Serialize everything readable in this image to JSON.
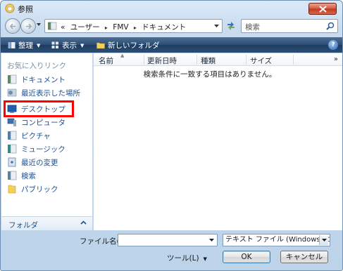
{
  "window": {
    "title": "参照",
    "colors": {
      "toolbar": "#2c4d73",
      "highlight_box": "#ff0000",
      "link_text": "#1f4f8f"
    }
  },
  "address": {
    "prefix": "«",
    "crumbs": [
      "ユーザー",
      "FMV",
      "ドキュメント"
    ],
    "separator": "▸"
  },
  "search": {
    "placeholder": "検索"
  },
  "toolbar": {
    "organize_label": "整理",
    "views_label": "表示",
    "new_folder_label": "新しいフォルダ",
    "help_glyph": "?"
  },
  "sidebar": {
    "header": "お気に入りリンク",
    "items": [
      {
        "label": "ドキュメント",
        "icon": "documents-icon"
      },
      {
        "label": "最近表示した場所",
        "icon": "recent-places-icon"
      },
      {
        "label": "デスクトップ",
        "icon": "desktop-icon"
      },
      {
        "label": "コンピュータ",
        "icon": "computer-icon"
      },
      {
        "label": "ピクチャ",
        "icon": "pictures-icon"
      },
      {
        "label": "ミュージック",
        "icon": "music-icon"
      },
      {
        "label": "最近の変更",
        "icon": "recently-changed-icon"
      },
      {
        "label": "検索",
        "icon": "searches-icon"
      },
      {
        "label": "パブリック",
        "icon": "public-icon"
      }
    ],
    "folders_label": "フォルダ",
    "folders_chevron": "^"
  },
  "filelist": {
    "columns": [
      "名前",
      "更新日時",
      "種類",
      "サイズ"
    ],
    "more": "»",
    "empty_message": "検索条件に一致する項目はありません。"
  },
  "bottom": {
    "filename_label": "ファイル名(N):",
    "filename_value": "",
    "filetype_value": "テキスト ファイル (Windows, カンマ",
    "tools_label": "ツール(L)",
    "ok_label": "OK",
    "cancel_label": "キャンセル"
  }
}
